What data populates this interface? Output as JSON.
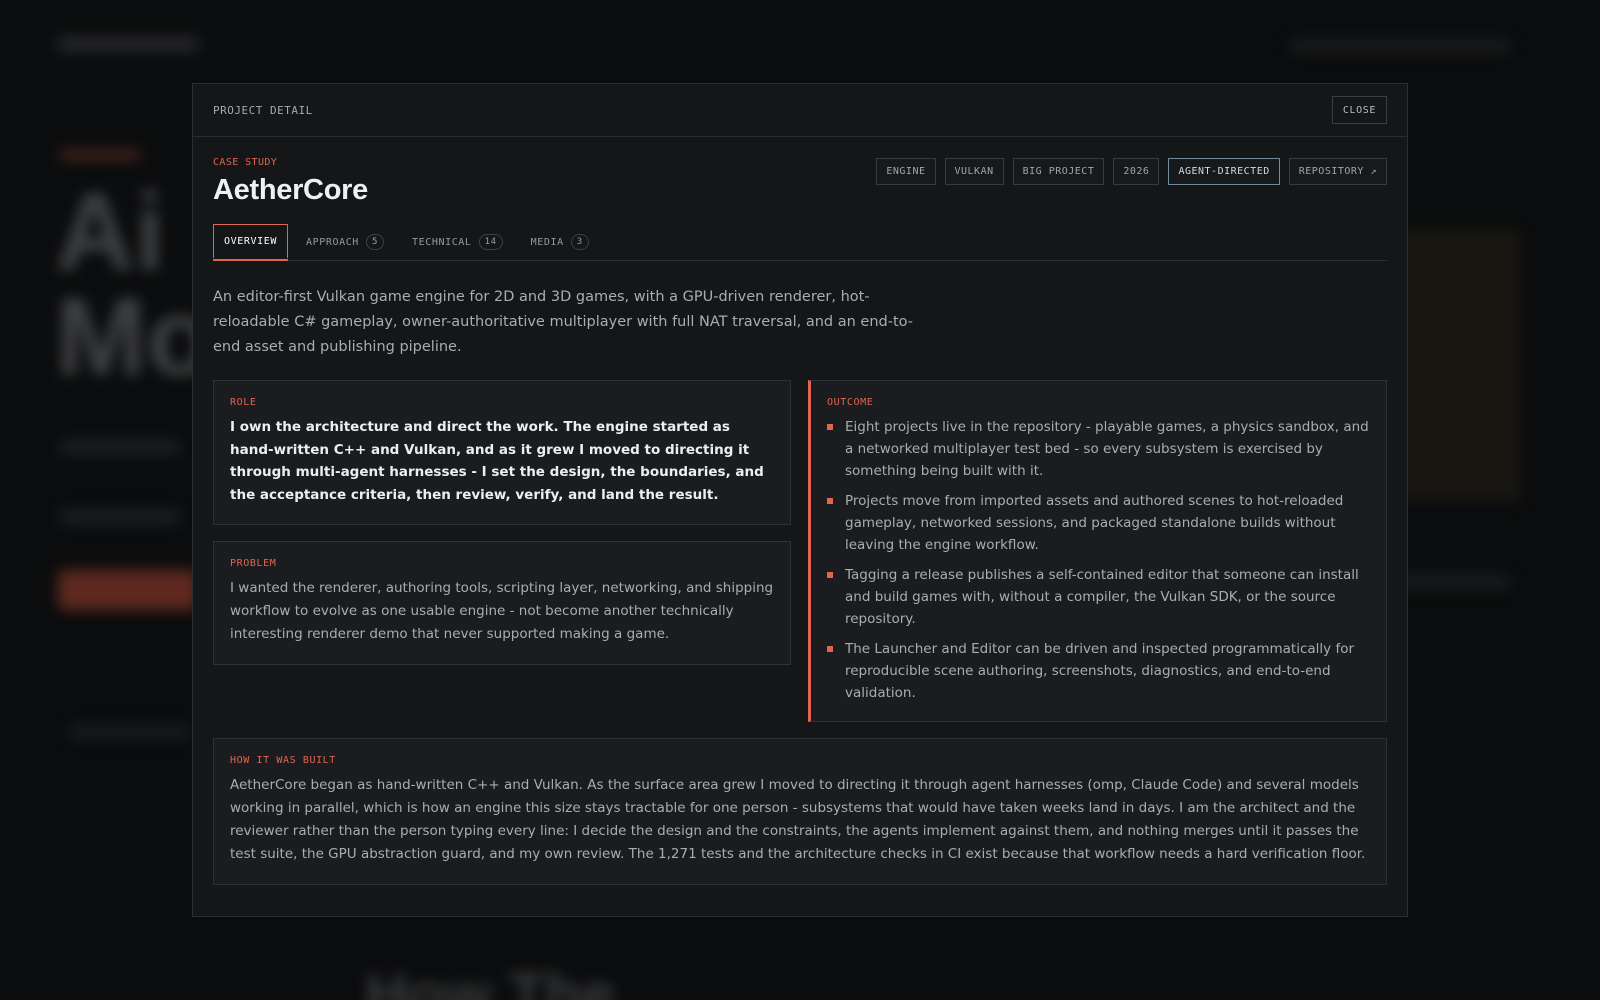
{
  "modal": {
    "header_label": "PROJECT DETAIL",
    "close_label": "CLOSE",
    "eyebrow": "CASE STUDY",
    "title": "AetherCore",
    "tags": [
      "ENGINE",
      "VULKAN",
      "BIG PROJECT",
      "2026",
      "AGENT-DIRECTED"
    ],
    "repository_label": "REPOSITORY ↗",
    "tabs": [
      {
        "label": "OVERVIEW",
        "count": ""
      },
      {
        "label": "APPROACH",
        "count": "5"
      },
      {
        "label": "TECHNICAL",
        "count": "14"
      },
      {
        "label": "MEDIA",
        "count": "3"
      }
    ],
    "intro": "An editor-first Vulkan game engine for 2D and 3D games, with a GPU-driven renderer, hot-reloadable C# gameplay, owner-authoritative multiplayer with full NAT traversal, and an end-to-end asset and publishing pipeline.",
    "role": {
      "label": "ROLE",
      "text": "I own the architecture and direct the work. The engine started as hand-written C++ and Vulkan, and as it grew I moved to directing it through multi-agent harnesses - I set the design, the boundaries, and the acceptance criteria, then review, verify, and land the result."
    },
    "problem": {
      "label": "PROBLEM",
      "text": "I wanted the renderer, authoring tools, scripting layer, networking, and shipping workflow to evolve as one usable engine - not become another technically interesting renderer demo that never supported making a game."
    },
    "outcome": {
      "label": "OUTCOME",
      "items": [
        "Eight projects live in the repository - playable games, a physics sandbox, and a networked multiplayer test bed - so every subsystem is exercised by something being built with it.",
        "Projects move from imported assets and authored scenes to hot-reloaded gameplay, networked sessions, and packaged standalone builds without leaving the engine workflow.",
        "Tagging a release publishes a self-contained editor that someone can install and build games with, without a compiler, the Vulkan SDK, or the source repository.",
        "The Launcher and Editor can be driven and inspected programmatically for reproducible scene authoring, screenshots, diagnostics, and end-to-end validation."
      ]
    },
    "built": {
      "label": "HOW IT WAS BUILT",
      "text": "AetherCore began as hand-written C++ and Vulkan. As the surface area grew I moved to directing it through agent harnesses (omp, Claude Code) and several models working in parallel, which is how an engine this size stays tractable for one person - subsystems that would have taken weeks land in days. I am the architect and the reviewer rather than the person typing every line: I decide the design and the constraints, the agents implement against them, and nothing merges until it passes the test suite, the GPU abstraction guard, and my own review. The 1,271 tests and the architecture checks in CI exist because that workflow needs a hard verification floor."
    }
  }
}
